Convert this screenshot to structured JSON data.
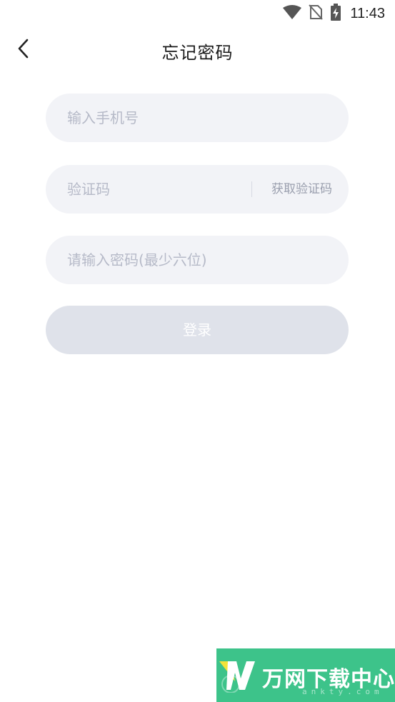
{
  "status_bar": {
    "time": "11:43",
    "icons": [
      "wifi-icon",
      "no-sim-icon",
      "battery-charging-icon"
    ]
  },
  "header": {
    "title": "忘记密码",
    "back_icon": "chevron-left-icon"
  },
  "form": {
    "phone_placeholder": "输入手机号",
    "code_placeholder": "验证码",
    "get_code_label": "获取验证码",
    "password_placeholder": "请输入密码(最少六位)",
    "login_label": "登录"
  },
  "watermark": {
    "brand": "万网下载中心",
    "url": "ankty.com"
  },
  "colors": {
    "field_bg": "#f2f3f7",
    "placeholder": "#b6bac8",
    "button_disabled_bg": "#dfe2ea",
    "watermark_bg": "#3dc38a"
  }
}
